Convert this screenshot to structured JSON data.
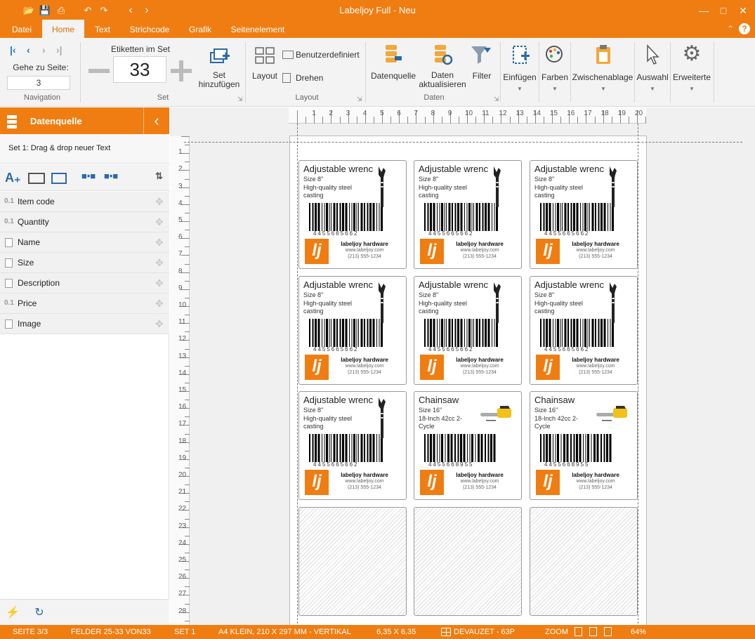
{
  "window": {
    "title": "Labeljoy Full - Neu"
  },
  "tabs": [
    {
      "label": "Datei",
      "active": false
    },
    {
      "label": "Home",
      "active": true
    },
    {
      "label": "Text",
      "active": false
    },
    {
      "label": "Strichcode",
      "active": false
    },
    {
      "label": "Grafik",
      "active": false
    },
    {
      "label": "Seitenelement",
      "active": false
    }
  ],
  "ribbon": {
    "navigation": {
      "goto_label": "Gehe zu Seite:",
      "page_value": "3",
      "group_label": "Navigation"
    },
    "set": {
      "count_label": "Etiketten im Set",
      "count_value": "33",
      "add_label": "Set hinzufügen",
      "group_label": "Set"
    },
    "layout": {
      "layout_label": "Layout",
      "custom_label": "Benutzerdefiniert",
      "rotate_label": "Drehen",
      "group_label": "Layout"
    },
    "daten": {
      "source_label": "Datenquelle",
      "refresh_label": "Daten aktualisieren",
      "filter_label": "Filter",
      "group_label": "Daten"
    },
    "einfuegen": "Einfügen",
    "farben": "Farben",
    "zwischenablage": "Zwischenablage",
    "auswahl": "Auswahl",
    "erweiterte": "Erweiterte"
  },
  "datasource": {
    "title": "Datenquelle",
    "set_text": "Set 1: Drag & drop neuer Text",
    "fields": [
      {
        "prefix": "0.1",
        "type": "number",
        "name": "Item code"
      },
      {
        "prefix": "0.1",
        "type": "number",
        "name": "Quantity"
      },
      {
        "prefix": "",
        "type": "text",
        "name": "Name"
      },
      {
        "prefix": "",
        "type": "text",
        "name": "Size"
      },
      {
        "prefix": "",
        "type": "text",
        "name": "Description"
      },
      {
        "prefix": "0.1",
        "type": "number",
        "name": "Price"
      },
      {
        "prefix": "",
        "type": "text",
        "name": "Image"
      }
    ]
  },
  "ruler": {
    "h": [
      "1",
      "2",
      "3",
      "4",
      "5",
      "6",
      "7",
      "8",
      "9",
      "10",
      "11",
      "12",
      "13",
      "14",
      "15",
      "16",
      "17",
      "18",
      "19",
      "20"
    ],
    "v": [
      "1",
      "2",
      "3",
      "4",
      "5",
      "6",
      "7",
      "8",
      "9",
      "10",
      "11",
      "12",
      "13",
      "14",
      "15",
      "16",
      "17",
      "18",
      "19",
      "20",
      "21",
      "22",
      "23",
      "24",
      "25",
      "26",
      "27",
      "28"
    ]
  },
  "labels": [
    {
      "title": "Adjustable wrenc",
      "size": "Size 8\"",
      "desc": "High-quality steel casting",
      "barcode": "4455665662",
      "company": "labeljoy hardware",
      "web": "www.labeljoy.com",
      "phone": "(213) 555-1234",
      "image": "wrench-image",
      "empty": false
    },
    {
      "title": "Adjustable wrenc",
      "size": "Size 8\"",
      "desc": "High-quality steel casting",
      "barcode": "4455665662",
      "company": "labeljoy hardware",
      "web": "www.labeljoy.com",
      "phone": "(213) 555-1234",
      "image": "wrench-image",
      "empty": false
    },
    {
      "title": "Adjustable wrenc",
      "size": "Size 8\"",
      "desc": "High-quality steel casting",
      "barcode": "4455665662",
      "company": "labeljoy hardware",
      "web": "www.labeljoy.com",
      "phone": "(213) 555-1234",
      "image": "wrench-image",
      "empty": false
    },
    {
      "title": "Adjustable wrenc",
      "size": "Size 8\"",
      "desc": "High-quality steel casting",
      "barcode": "4455665662",
      "company": "labeljoy hardware",
      "web": "www.labeljoy.com",
      "phone": "(213) 555-1234",
      "image": "wrench-image",
      "empty": false
    },
    {
      "title": "Adjustable wrenc",
      "size": "Size 8\"",
      "desc": "High-quality steel casting",
      "barcode": "4455665662",
      "company": "labeljoy hardware",
      "web": "www.labeljoy.com",
      "phone": "(213) 555-1234",
      "image": "wrench-image",
      "empty": false
    },
    {
      "title": "Adjustable wrenc",
      "size": "Size 8\"",
      "desc": "High-quality steel casting",
      "barcode": "4455665662",
      "company": "labeljoy hardware",
      "web": "www.labeljoy.com",
      "phone": "(213) 555-1234",
      "image": "wrench-image",
      "empty": false
    },
    {
      "title": "Adjustable wrenc",
      "size": "Size 8\"",
      "desc": "High-quality steel casting",
      "barcode": "4455665662",
      "company": "labeljoy hardware",
      "web": "www.labeljoy.com",
      "phone": "(213) 555-1234",
      "image": "wrench-image",
      "empty": false
    },
    {
      "title": "Chainsaw",
      "size": "Size 16\"",
      "desc": "18-Inch 42cc 2-Cycle",
      "barcode": "4455668955",
      "company": "labeljoy hardware",
      "web": "www.labeljoy.com",
      "phone": "(213) 555-1234",
      "image": "chainsaw-image",
      "empty": false
    },
    {
      "title": "Chainsaw",
      "size": "Size 16\"",
      "desc": "18-Inch 42cc 2-Cycle",
      "barcode": "4455668955",
      "company": "labeljoy hardware",
      "web": "www.labeljoy.com",
      "phone": "(213) 555-1234",
      "image": "chainsaw-image",
      "empty": false
    },
    {
      "empty": true
    },
    {
      "empty": true
    },
    {
      "empty": true
    }
  ],
  "logo_text": "lj",
  "status": {
    "page": "SEITE 3/3",
    "fields": "FELDER 25-33 VON33",
    "set": "SET 1",
    "paper": "A4 KLEIN, 210 X 297 MM - VERTIKAL",
    "label_size": "6,35 X 6,35",
    "template": "DEVAUZET - 63P",
    "zoom_label": "ZOOM",
    "zoom_value": "64%"
  },
  "colors": {
    "accent": "#f07d11",
    "icon_blue": "#1f74c7"
  }
}
